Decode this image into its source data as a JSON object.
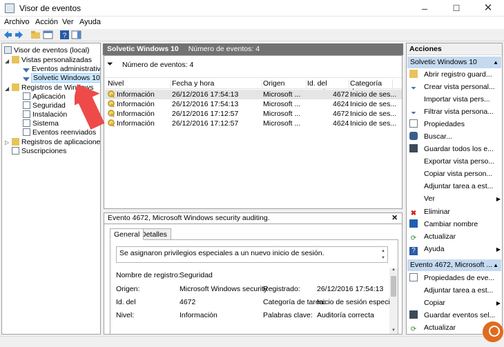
{
  "window": {
    "title": "Visor de eventos",
    "controls": {
      "minimize": "–",
      "maximize": "☐",
      "close": "✕"
    }
  },
  "menu": [
    "Archivo",
    "Acción",
    "Ver",
    "Ayuda"
  ],
  "tree": {
    "root": "Visor de eventos (local)",
    "custom_views": "Vistas personalizadas",
    "admin_events": "Eventos administrativos",
    "selected_view": "Solvetic Windows 10",
    "windows_logs": "Registros de Windows",
    "logs": [
      "Aplicación",
      "Seguridad",
      "Instalación",
      "Sistema",
      "Eventos reenviados"
    ],
    "app_services": "Registros de aplicaciones y s",
    "subscriptions": "Suscripciones"
  },
  "center": {
    "header_title": "Solvetic Windows 10",
    "header_count": "Número de eventos: 4",
    "filter_text": "Número de eventos: 4",
    "columns": [
      "Nivel",
      "Fecha y hora",
      "Origen",
      "Id. del evento",
      "Categoría d..."
    ],
    "rows": [
      {
        "level": "Información",
        "datetime": "26/12/2016 17:54:13",
        "source": "Microsoft ...",
        "id": "4672",
        "category": "Inicio de ses..."
      },
      {
        "level": "Información",
        "datetime": "26/12/2016 17:54:13",
        "source": "Microsoft ...",
        "id": "4624",
        "category": "Inicio de ses..."
      },
      {
        "level": "Información",
        "datetime": "26/12/2016 17:12:57",
        "source": "Microsoft ...",
        "id": "4672",
        "category": "Inicio de ses..."
      },
      {
        "level": "Información",
        "datetime": "26/12/2016 17:12:57",
        "source": "Microsoft ...",
        "id": "4624",
        "category": "Inicio de ses..."
      }
    ]
  },
  "detail": {
    "title": "Evento 4672, Microsoft Windows security auditing.",
    "close": "✕",
    "tabs": [
      "General",
      "Detalles"
    ],
    "message": "Se asignaron privilegios especiales a un nuevo inicio de sesión.",
    "fields": {
      "log_name_label": "Nombre de registro:",
      "log_name_value": "Seguridad",
      "source_label": "Origen:",
      "source_value": "Microsoft Windows security",
      "logged_label": "Registrado:",
      "logged_value": "26/12/2016 17:54:13",
      "id_label": "Id. del",
      "id_value": "4672",
      "task_label": "Categoría de tarea:",
      "task_value": "Inicio de sesión especial",
      "level_label": "Nivel:",
      "level_value": "Información",
      "keywords_label": "Palabras clave:",
      "keywords_value": "Auditoría correcta"
    }
  },
  "actions": {
    "title": "Acciones",
    "section1": "Solvetic Windows 10",
    "items1": [
      {
        "label": "Abrir registro guard...",
        "icon": "folder-open-icon"
      },
      {
        "label": "Crear vista personal...",
        "icon": "filter-new-icon"
      },
      {
        "label": "Importar vista pers...",
        "icon": "import-icon"
      },
      {
        "label": "Filtrar vista persona...",
        "icon": "filter-icon"
      },
      {
        "label": "Propiedades",
        "icon": "properties-icon"
      },
      {
        "label": "Buscar...",
        "icon": "binoculars-icon"
      },
      {
        "label": "Guardar todos los e...",
        "icon": "save-icon"
      },
      {
        "label": "Exportar vista perso...",
        "icon": "export-icon"
      },
      {
        "label": "Copiar vista person...",
        "icon": "copy-icon"
      },
      {
        "label": "Adjuntar tarea a est...",
        "icon": "task-icon"
      },
      {
        "label": "Ver",
        "icon": "view-icon"
      },
      {
        "label": "Eliminar",
        "icon": "delete-icon"
      },
      {
        "label": "Cambiar nombre",
        "icon": "rename-icon"
      },
      {
        "label": "Actualizar",
        "icon": "refresh-icon"
      },
      {
        "label": "Ayuda",
        "icon": "help-icon"
      }
    ],
    "section2": "Evento 4672, Microsoft ...",
    "items2": [
      {
        "label": "Propiedades de eve...",
        "icon": "properties-icon"
      },
      {
        "label": "Adjuntar tarea a est...",
        "icon": "task-icon"
      },
      {
        "label": "Copiar",
        "icon": "copy-icon"
      },
      {
        "label": "Guardar eventos sel...",
        "icon": "save-icon"
      },
      {
        "label": "Actualizar",
        "icon": "refresh-icon"
      }
    ]
  }
}
